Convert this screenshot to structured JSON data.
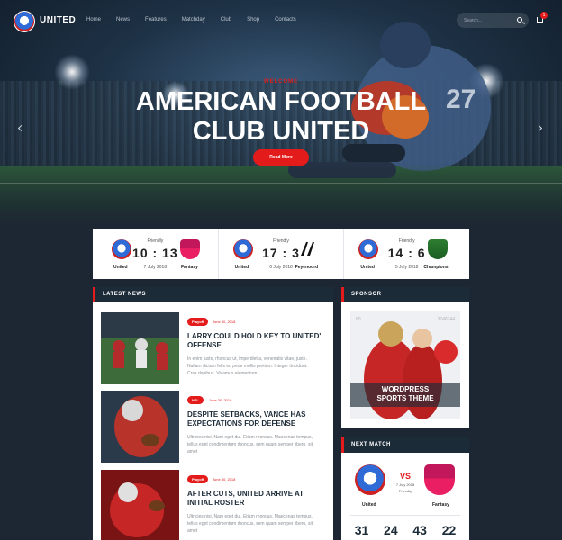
{
  "header": {
    "brand": "UNITED",
    "nav": [
      "Home",
      "News",
      "Features",
      "Matchday",
      "Club",
      "Shop",
      "Contacts"
    ],
    "search_placeholder": "Search...",
    "cart_count": "1"
  },
  "hero": {
    "kicker": "WELCOME",
    "title_line1": "AMERICAN FOOTBALL",
    "title_line2": "CLUB UNITED",
    "button": "Read More"
  },
  "scores": [
    {
      "home": "United",
      "away": "Fantasy",
      "type": "Friendly",
      "score": "10 : 13",
      "date": "7 July 2018"
    },
    {
      "home": "United",
      "away": "Feyenoord",
      "type": "Friendly",
      "score": "17 : 3",
      "date": "6 July 2018"
    },
    {
      "home": "United",
      "away": "Champions",
      "type": "Friendly",
      "score": "14 : 6",
      "date": "5 July 2018"
    }
  ],
  "latest_news": {
    "heading": "LATEST NEWS",
    "posts": [
      {
        "badge": "Playoff",
        "date": "June 30, 2018",
        "title": "LARRY COULD HOLD KEY TO UNITED' OFFENSE",
        "excerpt": "In enim justo, rhoncus ut, imperdiet a, venenatis vitae, justo. Nullam dictum felis eu pede mollis pretium. Integer tincidunt. Cras dapibus. Vivamus elementum"
      },
      {
        "badge": "NFL",
        "date": "June 30, 2018",
        "title": "DESPITE SETBACKS, VANCE HAS EXPECTATIONS FOR DEFENSE",
        "excerpt": "Ultricies nisi. Nam eget dui. Etiam rhoncus. Maecenas tempus, tellus eget condimentum rhoncus, sem quam semper libero, sit amet"
      },
      {
        "badge": "Playoff",
        "date": "June 30, 2018",
        "title": "AFTER CUTS, UNITED ARRIVE AT INITIAL ROSTER",
        "excerpt": "Ultricies nisi. Nam eget dui. Etiam rhoncus. Maecenas tempus, tellus eget condimentum rhoncus, sem quam semper libero, sit amet"
      }
    ]
  },
  "sponsor": {
    "heading": "SPONSOR",
    "text_line1": "WORDPRESS",
    "text_line2": "SPORTS THEME",
    "jersey_left": "80",
    "jersey_right": "3748344"
  },
  "next_match": {
    "heading": "NEXT MATCH",
    "vs": "VS",
    "date": "7 July 2018",
    "type": "Friendly",
    "home": "United",
    "away": "Fantasy",
    "countdown": [
      "31",
      "24",
      "43",
      "22"
    ]
  },
  "colors": {
    "accent": "#e31b1b",
    "dark": "#1c2b38",
    "background": "#1d2733"
  }
}
